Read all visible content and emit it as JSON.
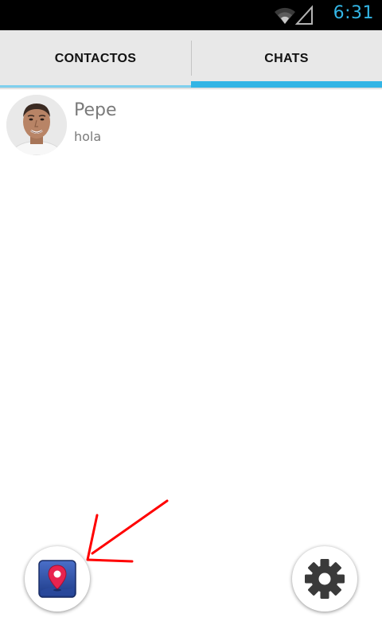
{
  "status_bar": {
    "time": "6:31",
    "icons": [
      "wifi-icon",
      "cell-signal-icon"
    ],
    "time_color": "#33b5e5"
  },
  "tabs": [
    {
      "label": "CONTACTOS",
      "selected": false
    },
    {
      "label": "CHATS",
      "selected": true
    }
  ],
  "accent_color": "#33b5e5",
  "chats": [
    {
      "name": "Pepe",
      "last_message": "hola",
      "avatar": "contact-photo"
    }
  ],
  "actions": {
    "map_button_icon": "map-pin-icon",
    "settings_button_icon": "gear-icon"
  },
  "annotation": {
    "type": "red-arrow",
    "points_to": "map-location-button",
    "color": "#ff0000"
  }
}
